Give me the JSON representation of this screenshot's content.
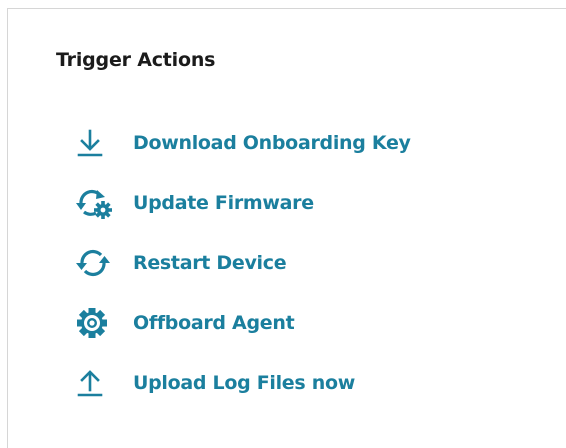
{
  "panel": {
    "title": "Trigger Actions",
    "accent_color": "#1b7f9e",
    "actions": [
      {
        "label": "Download Onboarding Key",
        "icon": "download-icon"
      },
      {
        "label": "Update Firmware",
        "icon": "refresh-gear-icon"
      },
      {
        "label": "Restart Device",
        "icon": "restart-icon"
      },
      {
        "label": "Offboard Agent",
        "icon": "gear-icon"
      },
      {
        "label": "Upload Log Files now",
        "icon": "upload-icon"
      }
    ]
  }
}
